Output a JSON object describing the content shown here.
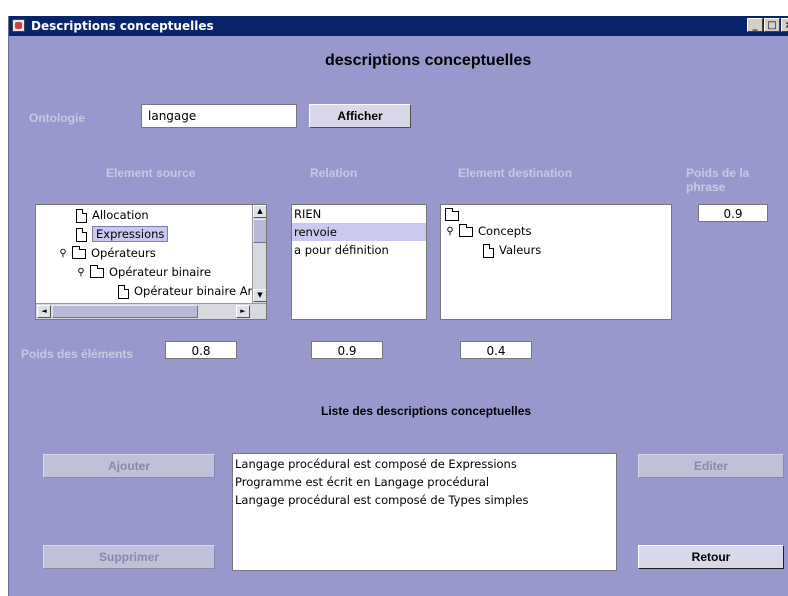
{
  "window": {
    "title": "Descriptions conceptuelles",
    "controls": [
      "_",
      "□",
      "×"
    ]
  },
  "heading": "descriptions conceptuelles",
  "ontologie": {
    "label": "Ontologie",
    "value": "langage",
    "button": "Afficher"
  },
  "columns": {
    "source": "Element source",
    "relation": "Relation",
    "destination": "Element destination",
    "poids_phrase": "Poids de la phrase"
  },
  "source_tree": [
    {
      "label": "Allocation",
      "type": "doc",
      "selected": false
    },
    {
      "label": "Expressions",
      "type": "doc",
      "selected": true
    },
    {
      "label": "Opérateurs",
      "type": "folder",
      "selected": false
    },
    {
      "label": "Opérateur binaire",
      "type": "folder",
      "selected": false
    },
    {
      "label": "Opérateur binaire Arit",
      "type": "doc",
      "selected": false
    }
  ],
  "relations": [
    {
      "label": "RIEN",
      "selected": false
    },
    {
      "label": "renvoie",
      "selected": true
    },
    {
      "label": "a pour définition",
      "selected": false
    }
  ],
  "destination_tree": [
    {
      "label": "",
      "type": "folder"
    },
    {
      "label": "Concepts",
      "type": "folder"
    },
    {
      "label": "Valeurs",
      "type": "doc"
    }
  ],
  "poids_phrase_value": "0.9",
  "poids": {
    "label": "Poids des éléments",
    "source": "0.8",
    "relation": "0.9",
    "destination": "0.4"
  },
  "liste": {
    "title": "Liste des descriptions conceptuelles",
    "items": [
      "Langage procédural est composé de Expressions",
      "Programme est écrit en Langage procédural",
      "Langage procédural est composé de Types simples"
    ]
  },
  "buttons": {
    "ajouter": "Ajouter",
    "supprimer": "Supprimer",
    "editer": "Editer",
    "retour": "Retour"
  },
  "scroll_icons": {
    "up": "▲",
    "down": "▼",
    "left": "◄",
    "right": "►"
  },
  "key_icon": "⚲"
}
